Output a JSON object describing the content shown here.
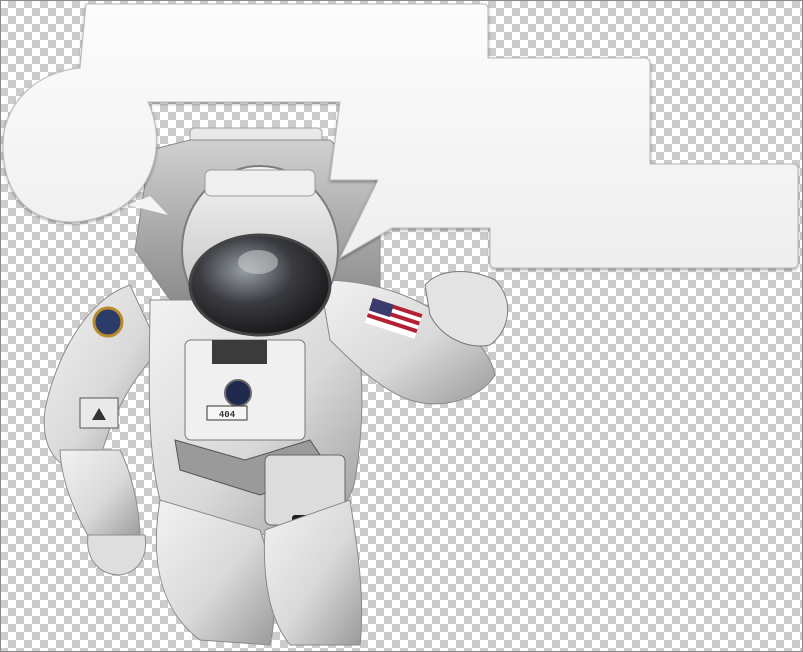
{
  "canvas": {
    "transparency_grid": true,
    "grid_colors": [
      "#ffffff",
      "#cccccc"
    ]
  },
  "photo": {
    "subject": "astronaut",
    "suit_patch_label": "404",
    "flag_icon": "us-flag-icon",
    "mission_patch_icon": "mission-patch-icon"
  },
  "bubbles": {
    "fill": "#f6f6f6",
    "shape": "thought",
    "count": 1
  }
}
